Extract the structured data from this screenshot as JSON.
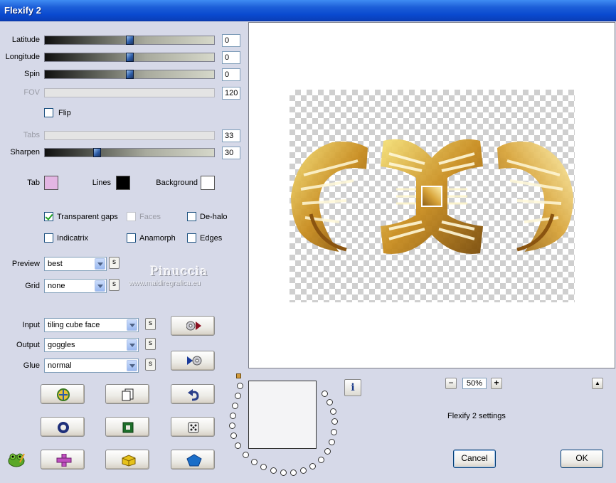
{
  "window": {
    "title": "Flexify 2"
  },
  "sliders": [
    {
      "label": "Latitude",
      "value": "0",
      "position": 0.5,
      "enabled": true
    },
    {
      "label": "Longitude",
      "value": "0",
      "position": 0.5,
      "enabled": true
    },
    {
      "label": "Spin",
      "value": "0",
      "position": 0.5,
      "enabled": true
    },
    {
      "label": "FOV",
      "value": "120",
      "enabled": false
    },
    {
      "label": "Tabs",
      "value": "33",
      "enabled": false
    },
    {
      "label": "Sharpen",
      "value": "30",
      "position": 0.3,
      "enabled": true
    }
  ],
  "flip": {
    "label": "Flip",
    "checked": false
  },
  "colors": {
    "tab": {
      "label": "Tab",
      "color": "#e3b6e3"
    },
    "lines": {
      "label": "Lines",
      "color": "#000000"
    },
    "background": {
      "label": "Background",
      "color": "#ffffff"
    }
  },
  "options": {
    "transparent_gaps": {
      "label": "Transparent gaps",
      "checked": true
    },
    "faces": {
      "label": "Faces",
      "checked": false
    },
    "dehalo": {
      "label": "De-halo",
      "checked": false
    },
    "indicatrix": {
      "label": "Indicatrix",
      "checked": false
    },
    "anamorph": {
      "label": "Anamorph",
      "checked": false
    },
    "edges": {
      "label": "Edges",
      "checked": false
    }
  },
  "dropdowns": {
    "preview": {
      "label": "Preview",
      "value": "best"
    },
    "grid": {
      "label": "Grid",
      "value": "none"
    },
    "input": {
      "label": "Input",
      "value": "tiling cube face"
    },
    "output": {
      "label": "Output",
      "value": "goggles"
    },
    "glue": {
      "label": "Glue",
      "value": "normal"
    }
  },
  "small_button_label": "s",
  "watermark": {
    "name": "Pinuccia",
    "url": "www.maidiregrafica.eu"
  },
  "zoom": {
    "minus": "−",
    "value": "50%",
    "plus": "+"
  },
  "info_button": "i",
  "up_button": "▲",
  "settings_title": "Flexify 2 settings",
  "buttons": {
    "cancel": "Cancel",
    "ok": "OK"
  },
  "accent_colors": {
    "title_bar": "#0a4ad0",
    "dialog_bg": "#d6d9e8"
  }
}
